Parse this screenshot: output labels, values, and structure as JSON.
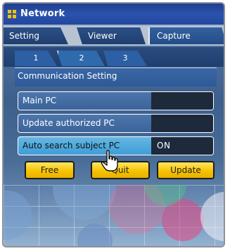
{
  "window": {
    "title": "Network"
  },
  "tabs": [
    {
      "label": "Setting"
    },
    {
      "label": "Viewer"
    },
    {
      "label": "Capture"
    }
  ],
  "subtabs": [
    {
      "label": "1"
    },
    {
      "label": "2"
    },
    {
      "label": "3"
    }
  ],
  "section": {
    "title": "Communication Setting"
  },
  "rows": [
    {
      "label": "Main PC",
      "value": ""
    },
    {
      "label": "Update authorized PC",
      "value": ""
    },
    {
      "label": "Auto search subject PC",
      "value": "ON"
    }
  ],
  "buttons": {
    "free": "Free",
    "quit": "Quit",
    "update": "Update"
  },
  "colors": {
    "accent": "#2b52ad",
    "button": "#f6c400",
    "highlight_row": "#4aa7dc"
  },
  "icons": {
    "app": "grid-icon",
    "cursor": "hand-pointer-icon"
  }
}
